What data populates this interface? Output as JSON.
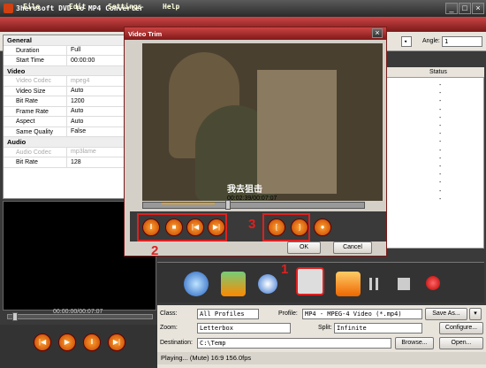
{
  "window": {
    "title": "3herosoft DVD to MP4 Converter"
  },
  "menu": [
    "File",
    "Edit",
    "Settings",
    "Help"
  ],
  "angle": {
    "label": "Angle:",
    "value": "1"
  },
  "properties": [
    {
      "type": "cat",
      "k": "General"
    },
    {
      "k": "Duration",
      "v": "Full"
    },
    {
      "k": "Start Time",
      "v": "00:00:00"
    },
    {
      "type": "cat",
      "k": "Video"
    },
    {
      "k": "Video Codec",
      "v": "mpeg4",
      "dis": true
    },
    {
      "k": "Video Size",
      "v": "Auto"
    },
    {
      "k": "Bit Rate",
      "v": "1200"
    },
    {
      "k": "Frame Rate",
      "v": "Auto"
    },
    {
      "k": "Aspect",
      "v": "Auto"
    },
    {
      "k": "Same Quality",
      "v": "False"
    },
    {
      "type": "cat",
      "k": "Audio"
    },
    {
      "k": "Audio Codec",
      "v": "mp3lame",
      "dis": true
    },
    {
      "k": "Bit Rate",
      "v": "128"
    }
  ],
  "list": {
    "col_target": "get",
    "col_status": "Status",
    "dashes": [
      "-",
      "-",
      "-",
      "-",
      "-",
      "-",
      "-",
      "-",
      "-",
      "-",
      "-",
      "-",
      "-",
      "-",
      "-"
    ]
  },
  "preview": {
    "time": "00:00:00/00:07:07"
  },
  "trim": {
    "title": "Video Trim",
    "subtitle": "我去狙击",
    "time": "00:02:39/00:07:07",
    "ok": "OK",
    "cancel": "Cancel"
  },
  "annotations": {
    "n1": "1",
    "n2": "2",
    "n3": "3"
  },
  "form": {
    "class_label": "Class:",
    "class_value": "All Profiles",
    "profile_label": "Profile:",
    "profile_value": "MP4 - MPEG-4 Video (*.mp4)",
    "save_as": "Save As...",
    "zoom_label": "Zoom:",
    "zoom_value": "Letterbox",
    "split_label": "Split:",
    "split_value": "Infinite",
    "configure": "Configure...",
    "dest_label": "Destination:",
    "dest_value": "C:\\Temp",
    "browse": "Browse...",
    "open": "Open..."
  },
  "status": {
    "text": "Playing... (Mute) 16:9  156.0fps"
  }
}
